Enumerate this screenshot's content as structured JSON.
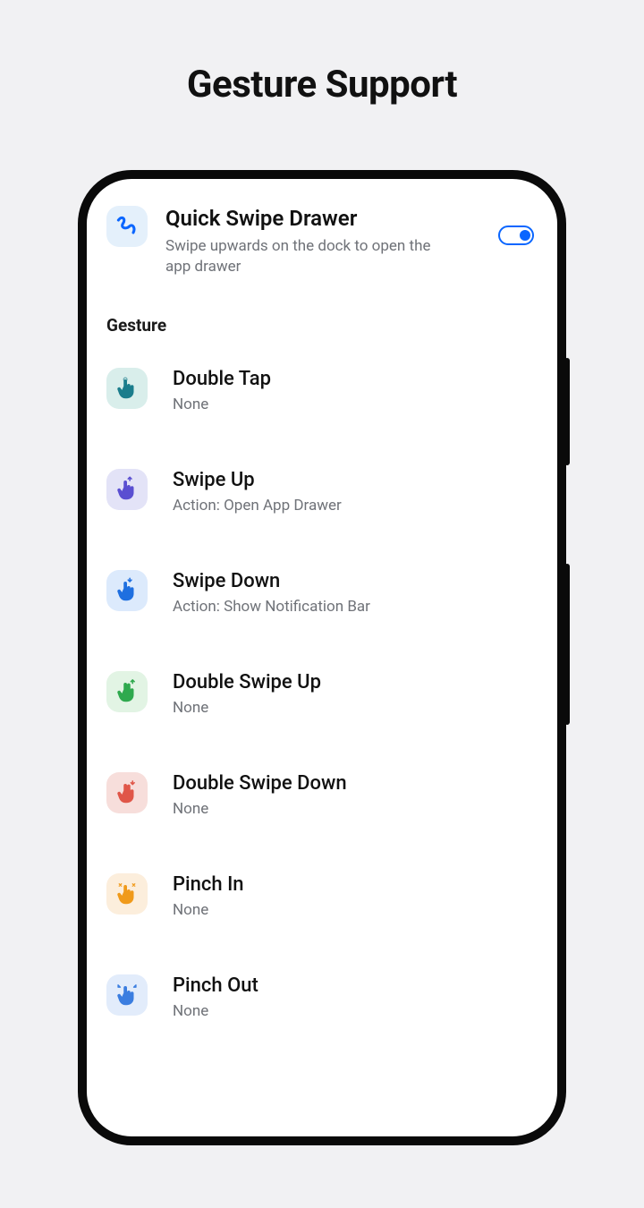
{
  "page_title": "Gesture Support",
  "hero": {
    "title": "Quick Swipe Drawer",
    "subtitle": "Swipe upwards on the dock to open the app drawer",
    "toggle_on": true
  },
  "section_label": "Gesture",
  "gestures": [
    {
      "icon": "tap",
      "tile": "bg-teal",
      "color": "#1b7d8c",
      "title": "Double Tap",
      "subtitle": "None"
    },
    {
      "icon": "swipe-up",
      "tile": "bg-lilac",
      "color": "#5a4fd1",
      "title": "Swipe Up",
      "subtitle": "Action: Open App Drawer"
    },
    {
      "icon": "swipe-down",
      "tile": "bg-sky",
      "color": "#1e6fe0",
      "title": "Swipe Down",
      "subtitle": "Action: Show Notification Bar"
    },
    {
      "icon": "two-up",
      "tile": "bg-mint",
      "color": "#2fa94e",
      "title": "Double Swipe Up",
      "subtitle": "None"
    },
    {
      "icon": "two-down",
      "tile": "bg-rose",
      "color": "#e05648",
      "title": "Double Swipe Down",
      "subtitle": "None"
    },
    {
      "icon": "pinch-in",
      "tile": "bg-amber",
      "color": "#f09a1a",
      "title": "Pinch In",
      "subtitle": "None"
    },
    {
      "icon": "pinch-out",
      "tile": "bg-blue2",
      "color": "#3a7de0",
      "title": "Pinch Out",
      "subtitle": "None"
    }
  ]
}
